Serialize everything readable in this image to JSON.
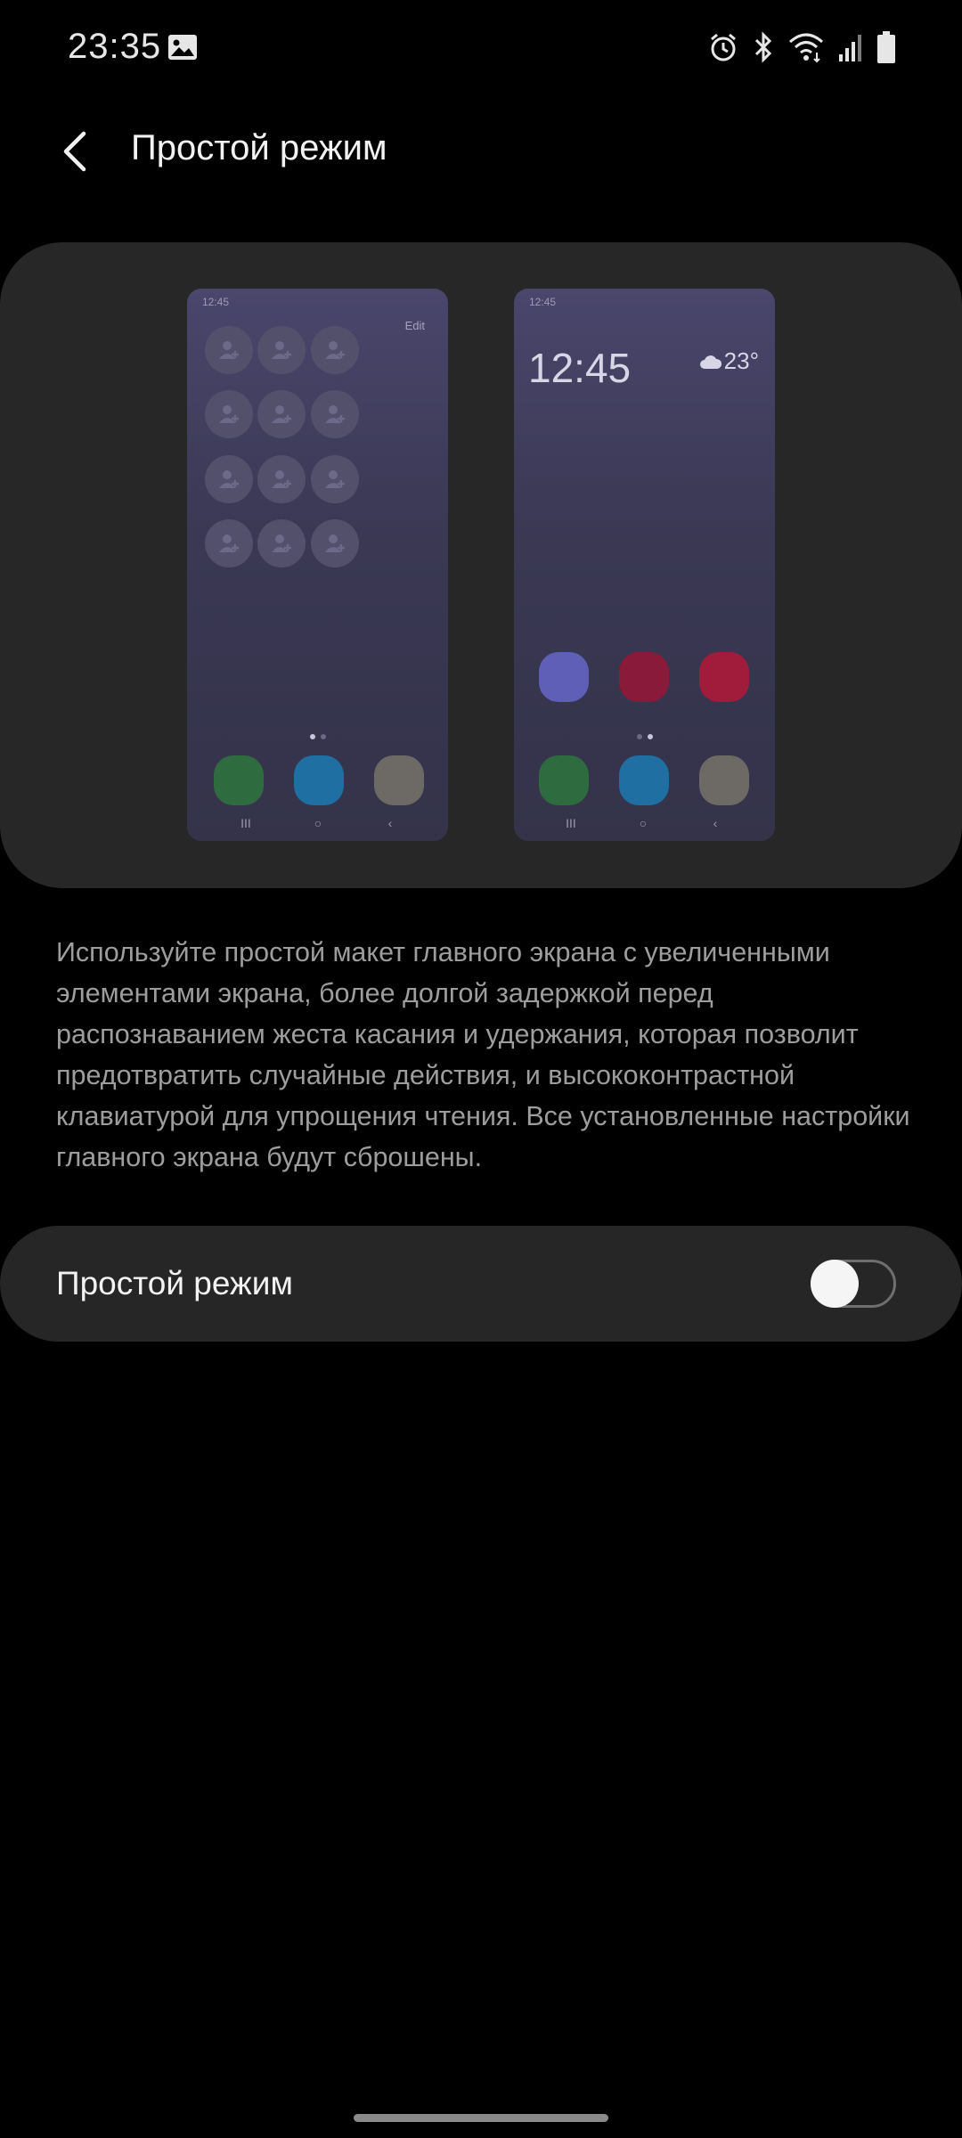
{
  "status_bar": {
    "time": "23:35",
    "icons": [
      "gallery-icon",
      "alarm-icon",
      "bluetooth-icon",
      "wifi-icon",
      "signal-icon",
      "battery-icon"
    ]
  },
  "header": {
    "title": "Простой режим",
    "back_icon": "chevron-left-icon"
  },
  "preview": {
    "standard": {
      "time": "12:45",
      "edit_label": "Edit",
      "dock_colors": [
        "#2e6b3f",
        "#1f6fa3",
        "#6d6a66"
      ]
    },
    "easy": {
      "time": "12:45",
      "clock": "12:45",
      "temperature": "23°",
      "app_colors": [
        "#5f5fb8",
        "#8a1a3a",
        "#a01c3a"
      ],
      "dock_colors": [
        "#2e6b3f",
        "#1f6fa3",
        "#6d6a66"
      ]
    }
  },
  "description": "Используйте простой макет главного экрана с увеличенными элементами экрана, более долгой задержкой перед распознаванием жеста касания и удержания, которая позволит предотвратить случайные действия, и высококонтрастной клавиатурой для упрощения чтения. Все установленные настройки главного экрана будут сброшены.",
  "toggle": {
    "label": "Простой режим",
    "enabled": false
  }
}
